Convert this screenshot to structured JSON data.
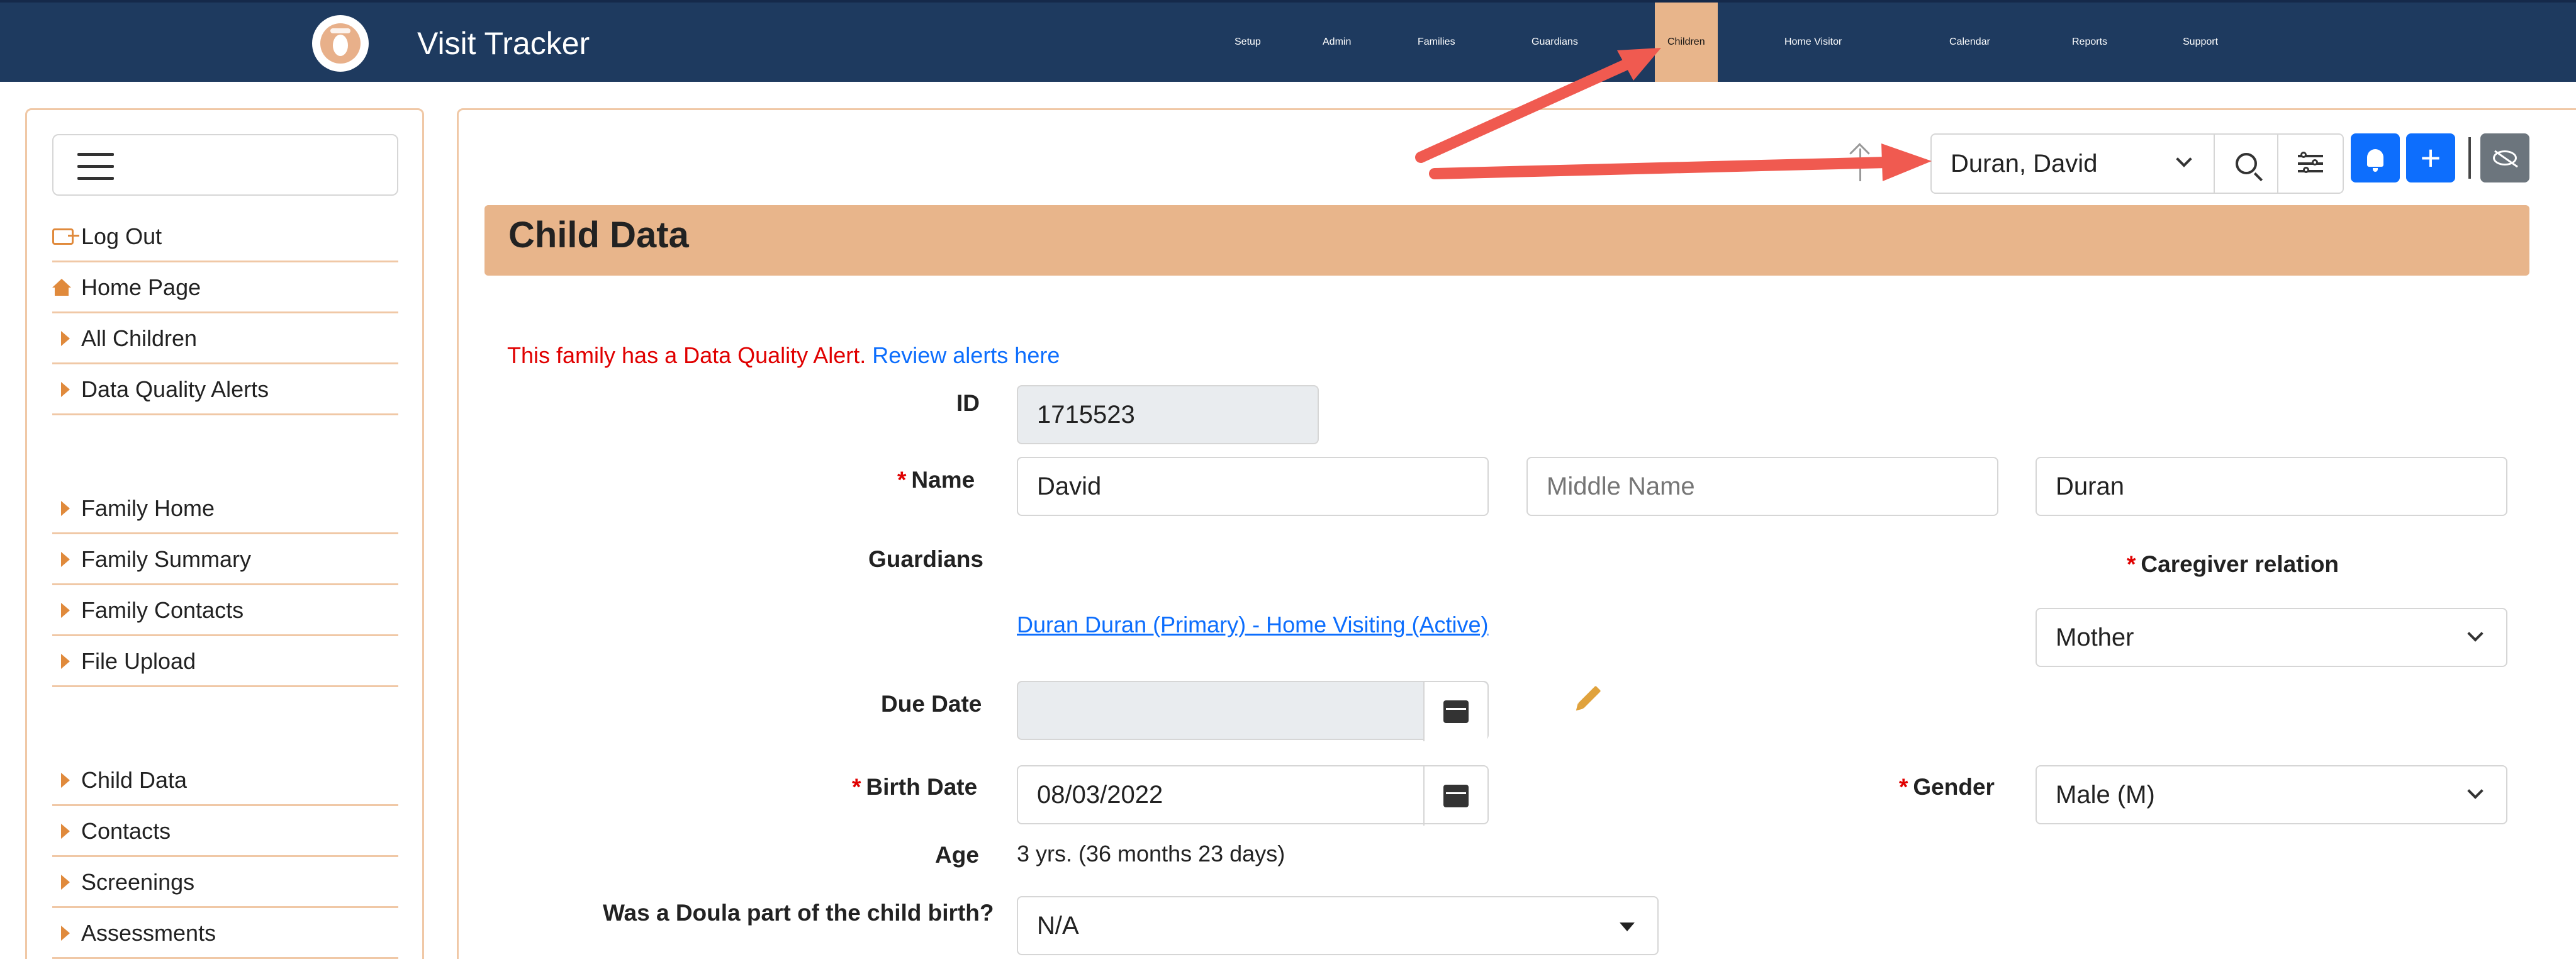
{
  "app": {
    "brand": "Visit Tracker",
    "logo_icon": "baby-foot-logo-icon"
  },
  "nav": {
    "items": [
      {
        "label": "Setup",
        "active": false
      },
      {
        "label": "Admin",
        "active": false
      },
      {
        "label": "Families",
        "active": false
      },
      {
        "label": "Guardians",
        "active": false
      },
      {
        "label": "Children",
        "active": true
      },
      {
        "label": "Home Visitor",
        "active": false
      },
      {
        "label": "Calendar",
        "active": false
      },
      {
        "label": "Reports",
        "active": false
      },
      {
        "label": "Support",
        "active": false
      }
    ],
    "active_color": "#e8b58b",
    "bar_color": "#1e3a5f"
  },
  "sidebar": {
    "menu_icon": "hamburger-icon",
    "items": [
      {
        "label": "Log Out",
        "icon": "logout-icon"
      },
      {
        "label": "Home Page",
        "icon": "home-icon"
      },
      {
        "label": "All Children",
        "icon": "caret-right-icon"
      },
      {
        "label": "Data Quality Alerts",
        "icon": "caret-right-icon"
      },
      {
        "label": "Family Home",
        "icon": "caret-right-icon"
      },
      {
        "label": "Family Summary",
        "icon": "caret-right-icon"
      },
      {
        "label": "Family Contacts",
        "icon": "caret-right-icon"
      },
      {
        "label": "File Upload",
        "icon": "caret-right-icon"
      },
      {
        "label": "Child Data",
        "icon": "caret-right-icon"
      },
      {
        "label": "Contacts",
        "icon": "caret-right-icon"
      },
      {
        "label": "Screenings",
        "icon": "caret-right-icon"
      },
      {
        "label": "Assessments",
        "icon": "caret-right-icon"
      }
    ],
    "accent": "#e08a3c"
  },
  "toolbar": {
    "child_select_value": "Duran, David",
    "search_icon": "search-icon",
    "filter_icon": "sliders-icon",
    "bell_icon": "bell-icon",
    "add_label": "+",
    "hide_icon": "eye-slash-icon",
    "up_icon": "arrow-up-icon"
  },
  "page": {
    "title": "Child Data",
    "alert_text": "This family has a Data Quality Alert.",
    "alert_link": "Review alerts here"
  },
  "form": {
    "id_label": "ID",
    "id_value": "1715523",
    "name_label": "Name",
    "first_name": "David",
    "middle_name_placeholder": "Middle Name",
    "last_name": "Duran",
    "guardians_label": "Guardians",
    "guardian_link": "Duran Duran (Primary) - Home Visiting (Active)",
    "caregiver_label": "Caregiver relation",
    "caregiver_value": "Mother",
    "due_date_label": "Due Date",
    "due_date_value": "",
    "birth_date_label": "Birth Date",
    "birth_date_value": "08/03/2022",
    "gender_label": "Gender",
    "gender_value": "Male (M)",
    "age_label": "Age",
    "age_value": "3 yrs. (36 months 23 days)",
    "doula_label": "Was a Doula part of the child birth?",
    "doula_value": "N/A",
    "required_mark": "*"
  },
  "annotation": {
    "arrow_color": "#f05a50"
  }
}
